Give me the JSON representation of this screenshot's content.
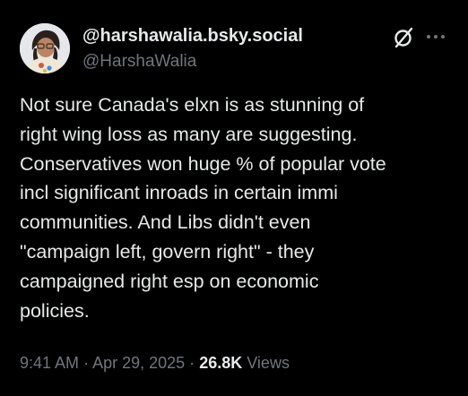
{
  "post": {
    "display_name": "@harshawalia.bsky.social",
    "handle": "@HarshaWalia",
    "avatar_icon": "profile-photo",
    "header_icons": [
      "grok-icon",
      "more-options-icon"
    ],
    "body_lines": [
      "Not sure Canada's elxn is as stunning of",
      "right wing loss as many are suggesting.",
      "Conservatives won huge % of popular vote",
      "incl significant inroads in certain immi",
      "communities. And Libs didn't even",
      "\"campaign left, govern right\" - they",
      "campaigned right esp on economic",
      "policies."
    ],
    "time": "9:41 AM",
    "separator": "·",
    "date": "Apr 29, 2025",
    "views_count": "26.8K",
    "views_label": "Views"
  },
  "colors": {
    "background": "#000000",
    "primary_text": "#e7e9ea",
    "secondary_text": "#71767b"
  }
}
